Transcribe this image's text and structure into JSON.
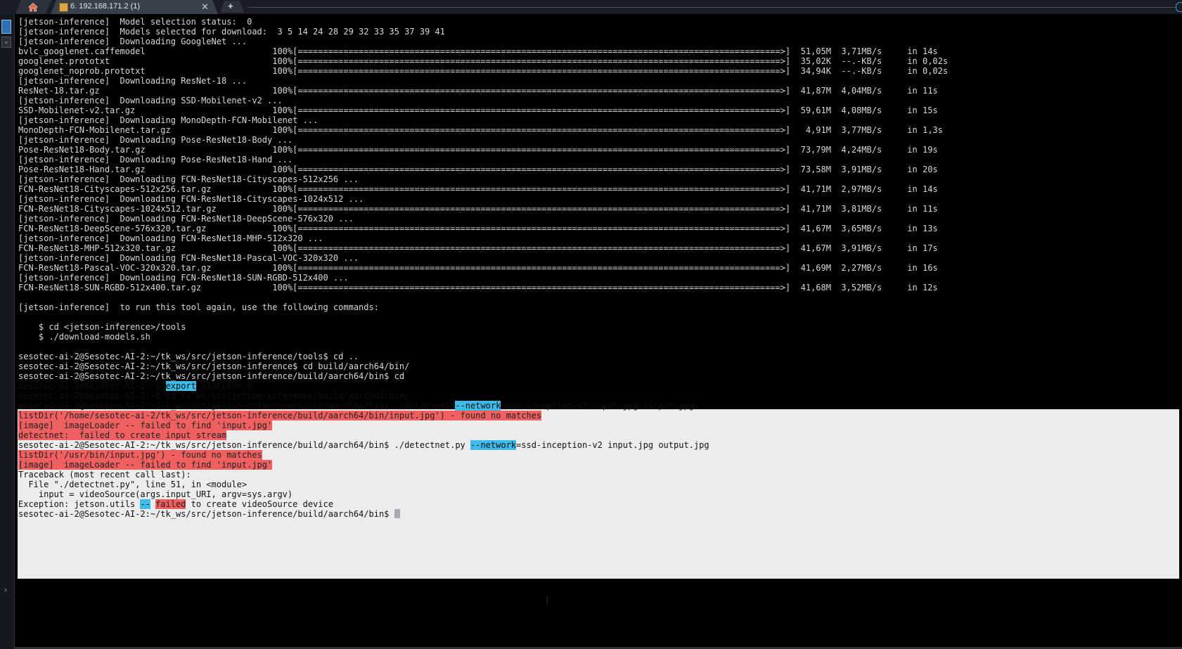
{
  "tabs": {
    "home_label": "",
    "session_title": "6. 192.168.171.2 (1)",
    "close_glyph": "✕",
    "new_tab_glyph": "+"
  },
  "terminal": {
    "prompt_tail": "sesotec-ai-2@Sesotec-AI-2:~/tk_ws/src/jetson-inference/build/aarch64/bin$ ",
    "lines": [
      {
        "segments": [
          {
            "t": "[jetson-inference]  Model selection status:  0"
          }
        ]
      },
      {
        "segments": [
          {
            "t": "[jetson-inference]  Models selected for download:  3 5 14 24 28 29 32 33 35 37 39 41"
          }
        ]
      },
      {
        "segments": [
          {
            "t": "[jetson-inference]  Downloading GoogleNet ..."
          }
        ]
      },
      {
        "segments": [
          {
            "t": "bvlc_googlenet.caffemodel                         100%[===============================================================================================>]  51,05M  3,71MB/s     in 14s"
          }
        ]
      },
      {
        "segments": [
          {
            "t": "googlenet.prototxt                                100%[===============================================================================================>]  35,02K  --.-KB/s     in 0,02s"
          }
        ]
      },
      {
        "segments": [
          {
            "t": "googlenet_noprob.prototxt                         100%[===============================================================================================>]  34,94K  --.-KB/s     in 0,02s"
          }
        ]
      },
      {
        "segments": [
          {
            "t": "[jetson-inference]  Downloading ResNet-18 ..."
          }
        ]
      },
      {
        "segments": [
          {
            "t": "ResNet-18.tar.gz                                  100%[===============================================================================================>]  41,87M  4,04MB/s     in 11s"
          }
        ]
      },
      {
        "segments": [
          {
            "t": "[jetson-inference]  Downloading SSD-Mobilenet-v2 ..."
          }
        ]
      },
      {
        "segments": [
          {
            "t": "SSD-Mobilenet-v2.tar.gz                           100%[===============================================================================================>]  59,61M  4,08MB/s     in 15s"
          }
        ]
      },
      {
        "segments": [
          {
            "t": "[jetson-inference]  Downloading MonoDepth-FCN-Mobilenet ..."
          }
        ]
      },
      {
        "segments": [
          {
            "t": "MonoDepth-FCN-Mobilenet.tar.gz                    100%[===============================================================================================>]   4,91M  3,77MB/s     in 1,3s"
          }
        ]
      },
      {
        "segments": [
          {
            "t": "[jetson-inference]  Downloading Pose-ResNet18-Body ..."
          }
        ]
      },
      {
        "segments": [
          {
            "t": "Pose-ResNet18-Body.tar.gz                         100%[===============================================================================================>]  73,79M  4,24MB/s     in 19s"
          }
        ]
      },
      {
        "segments": [
          {
            "t": "[jetson-inference]  Downloading Pose-ResNet18-Hand ..."
          }
        ]
      },
      {
        "segments": [
          {
            "t": "Pose-ResNet18-Hand.tar.gz                         100%[===============================================================================================>]  73,58M  3,91MB/s     in 20s"
          }
        ]
      },
      {
        "segments": [
          {
            "t": "[jetson-inference]  Downloading FCN-ResNet18-Cityscapes-512x256 ..."
          }
        ]
      },
      {
        "segments": [
          {
            "t": "FCN-ResNet18-Cityscapes-512x256.tar.gz            100%[===============================================================================================>]  41,71M  2,97MB/s     in 14s"
          }
        ]
      },
      {
        "segments": [
          {
            "t": "[jetson-inference]  Downloading FCN-ResNet18-Cityscapes-1024x512 ..."
          }
        ]
      },
      {
        "segments": [
          {
            "t": "FCN-ResNet18-Cityscapes-1024x512.tar.gz           100%[===============================================================================================>]  41,71M  3,81MB/s     in 11s"
          }
        ]
      },
      {
        "segments": [
          {
            "t": "[jetson-inference]  Downloading FCN-ResNet18-DeepScene-576x320 ..."
          }
        ]
      },
      {
        "segments": [
          {
            "t": "FCN-ResNet18-DeepScene-576x320.tar.gz             100%[===============================================================================================>]  41,67M  3,65MB/s     in 13s"
          }
        ]
      },
      {
        "segments": [
          {
            "t": "[jetson-inference]  Downloading FCN-ResNet18-MHP-512x320 ..."
          }
        ]
      },
      {
        "segments": [
          {
            "t": "FCN-ResNet18-MHP-512x320.tar.gz                   100%[===============================================================================================>]  41,67M  3,91MB/s     in 17s"
          }
        ]
      },
      {
        "segments": [
          {
            "t": "[jetson-inference]  Downloading FCN-ResNet18-Pascal-VOC-320x320 ..."
          }
        ]
      },
      {
        "segments": [
          {
            "t": "FCN-ResNet18-Pascal-VOC-320x320.tar.gz            100%[===============================================================================================>]  41,69M  2,27MB/s     in 16s"
          }
        ]
      },
      {
        "segments": [
          {
            "t": "[jetson-inference]  Downloading FCN-ResNet18-SUN-RGBD-512x400 ..."
          }
        ]
      },
      {
        "segments": [
          {
            "t": "FCN-ResNet18-SUN-RGBD-512x400.tar.gz              100%[===============================================================================================>]  41,68M  3,52MB/s     in 12s"
          }
        ]
      },
      {
        "segments": [
          {
            "t": ""
          }
        ]
      },
      {
        "segments": [
          {
            "t": "[jetson-inference]  to run this tool again, use the following commands:"
          }
        ]
      },
      {
        "segments": [
          {
            "t": ""
          }
        ]
      },
      {
        "segments": [
          {
            "t": "    $ cd <jetson-inference>/tools"
          }
        ]
      },
      {
        "segments": [
          {
            "t": "    $ ./download-models.sh"
          }
        ]
      },
      {
        "segments": [
          {
            "t": ""
          }
        ]
      },
      {
        "segments": [
          {
            "t": "sesotec-ai-2@Sesotec-AI-2:~/tk_ws/src/jetson-inference/tools$ cd .."
          }
        ]
      },
      {
        "segments": [
          {
            "t": "sesotec-ai-2@Sesotec-AI-2:~/tk_ws/src/jetson-inference$ cd build/aarch64/bin/"
          }
        ]
      },
      {
        "segments": [
          {
            "t": "sesotec-ai-2@Sesotec-AI-2:~/tk_ws/src/jetson-inference/build/aarch64/bin$ cd"
          }
        ]
      },
      {
        "dark": true,
        "segments": [
          {
            "t": "sesotec-ai-2@Sesotec-AI-2:~$ "
          },
          {
            "t": "export",
            "c": "blue"
          },
          {
            "t": " DISPLAY=:0"
          }
        ]
      },
      {
        "dark": true,
        "segments": [
          {
            "t": "sesotec-ai-2@Sesotec-AI-2:~$ cd tk_ws/src/jetson-inference/build/aarch64/bin/"
          }
        ]
      },
      {
        "dark": true,
        "segments": [
          {
            "t": "sesotec-ai-2@Sesotec-AI-2:~/tk_ws/src/jetson-inference/build/aarch64/bin$ ./detectnet "
          },
          {
            "t": "--network",
            "c": "blue"
          },
          {
            "t": "=ssd-inception-v2 input.jpg output.jpg"
          }
        ]
      },
      {
        "dark": true,
        "segments": [
          {
            "t": "listDir('/home/sesotec-ai-2/tk_ws/src/jetson-inference/build/aarch64/bin/input.jpg') - found no matches",
            "c": "red"
          }
        ]
      },
      {
        "dark": true,
        "segments": [
          {
            "t": "[image]  imageLoader -- failed to find 'input.jpg'",
            "c": "red"
          }
        ]
      },
      {
        "dark": true,
        "segments": [
          {
            "t": "detectnet:  failed to create input stream",
            "c": "red"
          }
        ]
      },
      {
        "dark": true,
        "segments": [
          {
            "t": "sesotec-ai-2@Sesotec-AI-2:~/tk_ws/src/jetson-inference/build/aarch64/bin$ ./detectnet.py "
          },
          {
            "t": "--network",
            "c": "blue"
          },
          {
            "t": "=ssd-inception-v2 input.jpg output.jpg"
          }
        ]
      },
      {
        "dark": true,
        "segments": [
          {
            "t": "listDir('/usr/bin/input.jpg') - found no matches",
            "c": "red"
          }
        ]
      },
      {
        "dark": true,
        "segments": [
          {
            "t": "[image]  imageLoader -- failed to find 'input.jpg'",
            "c": "red"
          }
        ]
      },
      {
        "dark": true,
        "segments": [
          {
            "t": "Traceback (most recent call last):"
          }
        ]
      },
      {
        "dark": true,
        "segments": [
          {
            "t": "  File \"./detectnet.py\", line 51, in <module>"
          }
        ]
      },
      {
        "dark": true,
        "segments": [
          {
            "t": "    input = videoSource(args.input_URI, argv=sys.argv)"
          }
        ]
      },
      {
        "dark": true,
        "segments": [
          {
            "t": "Exception: jetson.utils "
          },
          {
            "t": "--",
            "c": "blue"
          },
          {
            "t": " "
          },
          {
            "t": "failed",
            "c": "red"
          },
          {
            "t": " to create videoSource device"
          }
        ]
      },
      {
        "dark": true,
        "cursor": true,
        "segments": [
          {
            "t": "sesotec-ai-2@Sesotec-AI-2:~/tk_ws/src/jetson-inference/build/aarch64/bin$ "
          }
        ]
      }
    ]
  },
  "mouse_cursor_glyph": "I"
}
